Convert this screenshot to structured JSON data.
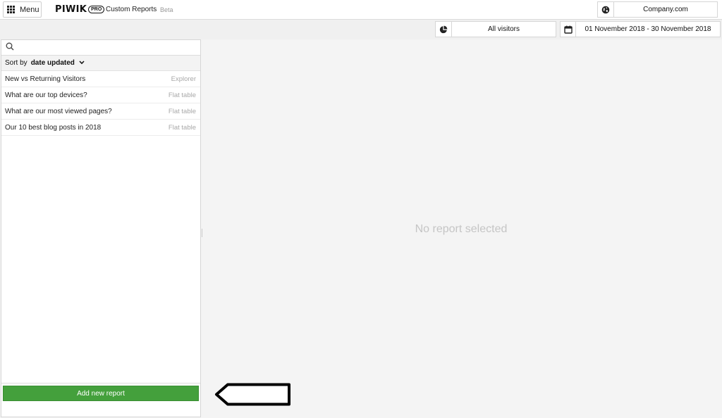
{
  "header": {
    "menu_label": "Menu",
    "logo_word": "PIWIK",
    "logo_badge": "PRO",
    "app_title": "Custom Reports",
    "app_badge": "Beta",
    "site_name": "Company.com",
    "site_icon": "globe-icon"
  },
  "filters": {
    "segment_icon": "pie-chart-icon",
    "segment_label": "All visitors",
    "date_icon": "calendar-icon",
    "date_range": "01 November 2018 - 30 November 2018"
  },
  "sidebar": {
    "search_placeholder": "",
    "sort_label": "Sort by",
    "sort_value": "date updated",
    "reports": [
      {
        "name": "New vs Returning Visitors",
        "type": "Explorer"
      },
      {
        "name": "What are our top devices?",
        "type": "Flat table"
      },
      {
        "name": "What are our most viewed pages?",
        "type": "Flat table"
      },
      {
        "name": "Our 10 best blog posts in 2018",
        "type": "Flat table"
      }
    ],
    "add_button_label": "Add new report"
  },
  "main": {
    "empty_message": "No report selected"
  },
  "colors": {
    "accent_green": "#44a03c",
    "muted_text": "#a8a8a8",
    "placeholder_text": "#c5c5c5"
  }
}
